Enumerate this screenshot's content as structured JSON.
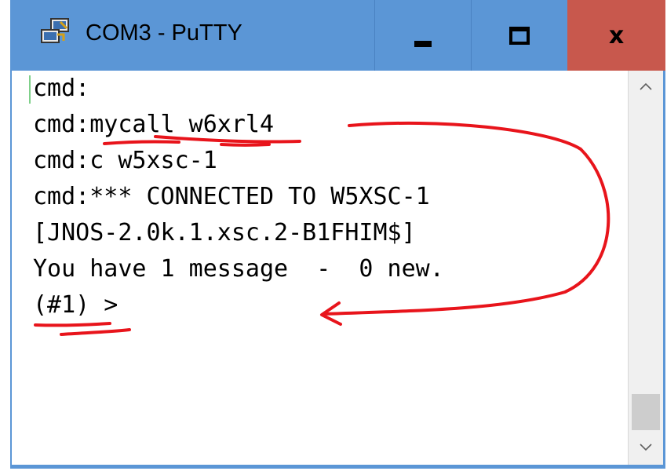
{
  "window": {
    "title": "COM3 - PuTTY",
    "app_icon": "putty-icon",
    "controls": {
      "minimize_icon": "minimize-icon",
      "maximize_icon": "maximize-icon",
      "close_label": "x"
    }
  },
  "terminal": {
    "lines": [
      "cmd:",
      "cmd:mycall w6xrl4",
      "cmd:c w5xsc-1",
      "cmd:*** CONNECTED TO W5XSC-1",
      "[JNOS-2.0k.1.xsc.2-B1FHIM$]",
      "You have 1 message  -  0 new.",
      "(#1) >"
    ]
  },
  "scrollbar": {
    "up_icon": "chevron-up-icon",
    "down_icon": "chevron-down-icon"
  },
  "colors": {
    "titlebar": "#5b96d6",
    "close_button": "#c8584d",
    "annotation": "#e8141b",
    "cursor": "#7fd08a"
  }
}
